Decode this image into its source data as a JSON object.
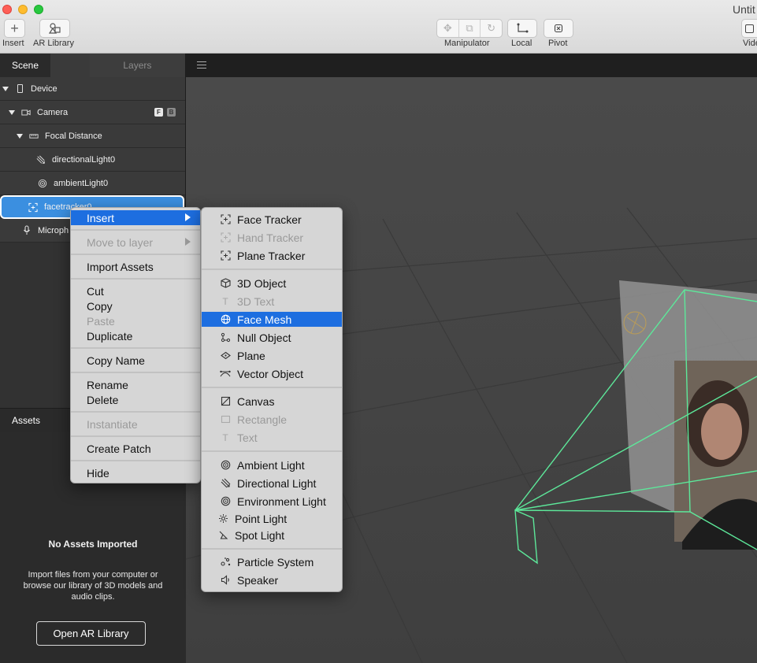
{
  "window": {
    "title": "Untit"
  },
  "toolbar": {
    "insert_label": "Insert",
    "ar_library_label": "AR Library",
    "manipulator_label": "Manipulator",
    "local_label": "Local",
    "pivot_label": "Pivot",
    "video_label": "Vide"
  },
  "left_panel": {
    "tabs": {
      "scene": "Scene",
      "layers": "Layers"
    },
    "tree": [
      {
        "label": "Device"
      },
      {
        "label": "Camera",
        "badges": [
          "F",
          "B"
        ]
      },
      {
        "label": "Focal Distance"
      },
      {
        "label": "directionalLight0"
      },
      {
        "label": "ambientLight0"
      },
      {
        "label": "facetracker0"
      },
      {
        "label": "Microph"
      }
    ],
    "assets": {
      "header": "Assets",
      "empty_title": "No Assets Imported",
      "empty_desc": "Import files from your computer or browse our library of 3D models and audio clips.",
      "open_button": "Open AR Library"
    }
  },
  "context_menu": {
    "items": [
      {
        "label": "Insert",
        "state": "highlighted",
        "submenu": true
      },
      {
        "label": "Move to layer",
        "state": "disabled",
        "submenu": true
      },
      {
        "label": "Import Assets"
      },
      {
        "label": "Cut"
      },
      {
        "label": "Copy"
      },
      {
        "label": "Paste",
        "state": "disabled"
      },
      {
        "label": "Duplicate"
      },
      {
        "label": "Copy Name"
      },
      {
        "label": "Rename"
      },
      {
        "label": "Delete"
      },
      {
        "label": "Instantiate",
        "state": "disabled"
      },
      {
        "label": "Create Patch"
      },
      {
        "label": "Hide"
      }
    ]
  },
  "insert_submenu": {
    "items": [
      {
        "label": "Face Tracker",
        "icon": "face-tracker-icon"
      },
      {
        "label": "Hand Tracker",
        "icon": "hand-tracker-icon",
        "state": "disabled"
      },
      {
        "label": "Plane Tracker",
        "icon": "plane-tracker-icon"
      },
      {
        "label": "3D Object",
        "icon": "cube-icon"
      },
      {
        "label": "3D Text",
        "icon": "text-icon",
        "state": "disabled"
      },
      {
        "label": "Face Mesh",
        "icon": "globe-icon",
        "state": "highlighted"
      },
      {
        "label": "Null Object",
        "icon": "null-object-icon"
      },
      {
        "label": "Plane",
        "icon": "plane-icon"
      },
      {
        "label": "Vector Object",
        "icon": "vector-object-icon"
      },
      {
        "label": "Canvas",
        "icon": "canvas-icon"
      },
      {
        "label": "Rectangle",
        "icon": "rectangle-icon",
        "state": "disabled"
      },
      {
        "label": "Text",
        "icon": "text-icon",
        "state": "disabled"
      },
      {
        "label": "Ambient Light",
        "icon": "ambient-light-icon"
      },
      {
        "label": "Directional Light",
        "icon": "directional-light-icon"
      },
      {
        "label": "Environment Light",
        "icon": "environment-light-icon"
      },
      {
        "label": "Point Light",
        "icon": "point-light-icon"
      },
      {
        "label": "Spot Light",
        "icon": "spot-light-icon"
      },
      {
        "label": "Particle System",
        "icon": "particle-system-icon"
      },
      {
        "label": "Speaker",
        "icon": "speaker-icon"
      }
    ]
  },
  "colors": {
    "highlight": "#1d6ee0",
    "selection": "#3b8fe0",
    "frustum": "#5de89a"
  }
}
